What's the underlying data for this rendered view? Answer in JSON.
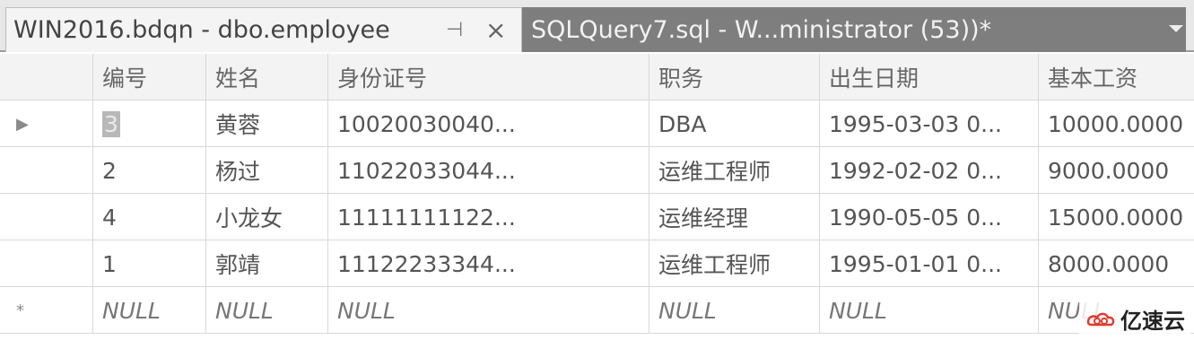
{
  "tabs": [
    {
      "label": "WIN2016.bdqn - dbo.employee",
      "active": true
    },
    {
      "label": "SQLQuery7.sql - W...ministrator (53))*",
      "active": false
    }
  ],
  "icons": {
    "pin": "pin-icon",
    "close": "close-icon",
    "dropdown": "chevron-down-icon"
  },
  "grid": {
    "columns": [
      "编号",
      "姓名",
      "身份证号",
      "职务",
      "出生日期",
      "基本工资"
    ],
    "rows": [
      {
        "indicator": "▶",
        "cells": [
          "3",
          "黄蓉",
          "10020030040...",
          "DBA",
          "1995-03-03 0...",
          "10000.0000"
        ]
      },
      {
        "indicator": "",
        "cells": [
          "2",
          "杨过",
          "11022033044...",
          "运维工程师",
          "1992-02-02 0...",
          "9000.0000"
        ]
      },
      {
        "indicator": "",
        "cells": [
          "4",
          "小龙女",
          "11111111122...",
          "运维经理",
          "1990-05-05 0...",
          "15000.0000"
        ]
      },
      {
        "indicator": "",
        "cells": [
          "1",
          "郭靖",
          "11122233344...",
          "运维工程师",
          "1995-01-01 0...",
          "8000.0000"
        ]
      },
      {
        "indicator": "*",
        "cells": [
          "NULL",
          "NULL",
          "NULL",
          "NULL",
          "NULL",
          "NULL"
        ]
      }
    ]
  },
  "watermark": {
    "text": "亿速云"
  },
  "colors": {
    "active_tab": "#f4f4f4",
    "inactive_tab": "#7e7e7e",
    "selected_cell": "#b8b8b8"
  }
}
